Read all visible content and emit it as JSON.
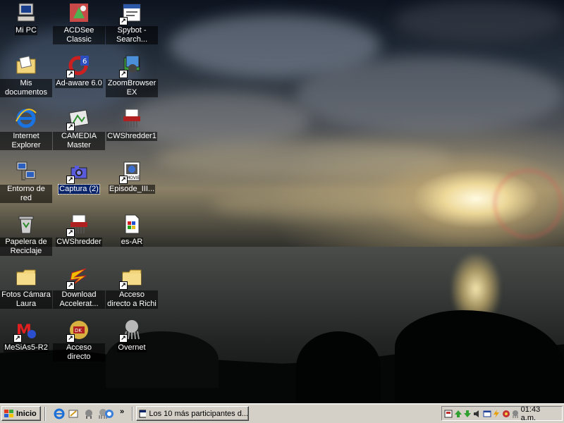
{
  "desktop": {
    "icons": [
      {
        "label": "Mi PC",
        "icon": "my-computer-icon",
        "shortcut": false,
        "selected": false
      },
      {
        "label": "ACDSee Classic",
        "icon": "acdsee-icon",
        "shortcut": false,
        "selected": false
      },
      {
        "label": "Spybot - Search...",
        "icon": "spybot-icon",
        "shortcut": true,
        "selected": false
      },
      {
        "label": "Mis documentos",
        "icon": "my-documents-folder-icon",
        "shortcut": false,
        "selected": false
      },
      {
        "label": "Ad-aware 6.0",
        "icon": "adaware-icon",
        "shortcut": true,
        "selected": false
      },
      {
        "label": "ZoomBrowser EX",
        "icon": "zoombrowser-icon",
        "shortcut": true,
        "selected": false
      },
      {
        "label": "Internet Explorer",
        "icon": "internet-explorer-icon",
        "shortcut": false,
        "selected": false
      },
      {
        "label": "CAMEDIA Master",
        "icon": "camedia-icon",
        "shortcut": true,
        "selected": false
      },
      {
        "label": "CWShredder1",
        "icon": "shredder-icon",
        "shortcut": false,
        "selected": false
      },
      {
        "label": "Entorno de red",
        "icon": "network-icon",
        "shortcut": false,
        "selected": false
      },
      {
        "label": "Captura (2)",
        "icon": "capture-camera-icon",
        "shortcut": true,
        "selected": true
      },
      {
        "label": "Episode_III...",
        "icon": "movie-file-icon",
        "shortcut": true,
        "selected": false
      },
      {
        "label": "Papelera de Reciclaje",
        "icon": "recycle-bin-icon",
        "shortcut": false,
        "selected": false
      },
      {
        "label": "CWShredder",
        "icon": "shredder-icon",
        "shortcut": true,
        "selected": false
      },
      {
        "label": "es-AR",
        "icon": "document-file-icon",
        "shortcut": false,
        "selected": false
      },
      {
        "label": "Fotos Cámara Laura",
        "icon": "folder-icon",
        "shortcut": false,
        "selected": false
      },
      {
        "label": "Download Accelerat...",
        "icon": "download-accelerator-icon",
        "shortcut": true,
        "selected": false
      },
      {
        "label": "Acceso directo a Richi",
        "icon": "folder-icon",
        "shortcut": true,
        "selected": false
      },
      {
        "label": "MeSiAs5-R2",
        "icon": "mesias-icon",
        "shortcut": true,
        "selected": false
      },
      {
        "label": "Acceso directo",
        "icon": "game-icon",
        "shortcut": true,
        "selected": false
      },
      {
        "label": "Overnet",
        "icon": "overnet-icon",
        "shortcut": true,
        "selected": false
      }
    ]
  },
  "taskbar": {
    "start_label": "Inicio",
    "quick_launch": [
      "internet-explorer-icon",
      "outlook-express-icon",
      "media-icon",
      "overnet-icon",
      "browser-icon"
    ],
    "overflow_label": "»",
    "task_button_label": "Los 10 más participantes d...",
    "tray_icons": [
      "tray-app-icon",
      "tray-network-up-icon",
      "tray-network-down-icon",
      "volume-icon",
      "tray-window-icon",
      "tray-lightning-icon",
      "tray-globe-icon",
      "tray-overnet-icon"
    ],
    "clock": "01:43 a.m."
  },
  "colors": {
    "taskbar_bg": "#d4d0c8",
    "selection_blue": "#0a246a"
  }
}
